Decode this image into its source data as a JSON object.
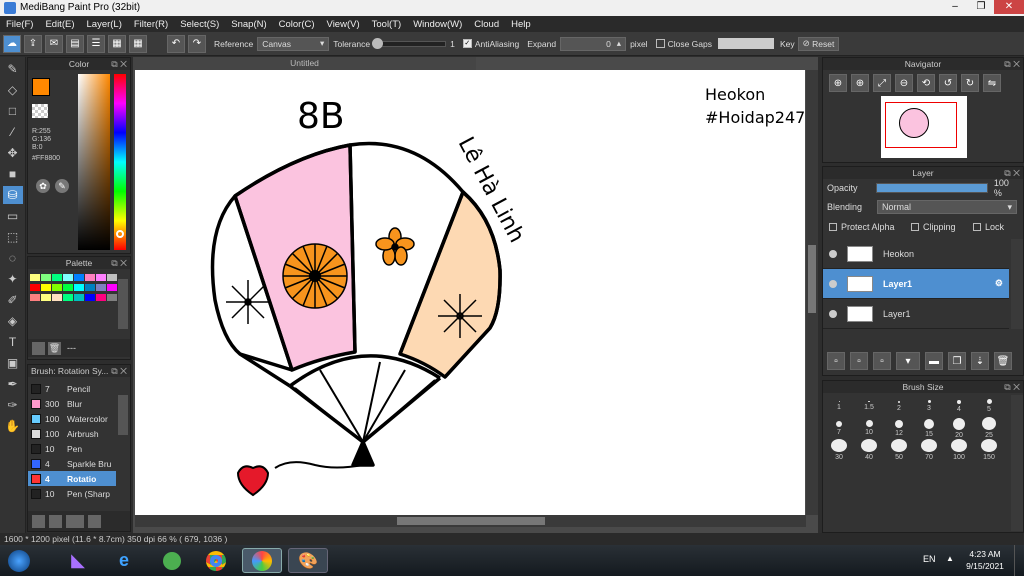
{
  "window": {
    "title": "MediBang Paint Pro (32bit)"
  },
  "menu": [
    "File(F)",
    "Edit(E)",
    "Layer(L)",
    "Filter(R)",
    "Select(S)",
    "Snap(N)",
    "Color(C)",
    "View(V)",
    "Tool(T)",
    "Window(W)",
    "Cloud",
    "Help"
  ],
  "toolbar": {
    "reference_label": "Reference",
    "reference_value": "Canvas",
    "tolerance_label": "Tolerance",
    "tolerance_value": "1",
    "antialias_label": "AntiAliasing",
    "expand_label": "Expand",
    "expand_value": "0",
    "expand_unit": "pixel",
    "close_gaps_label": "Close Gaps",
    "key_label": "Key",
    "reset_label": "Reset"
  },
  "color_panel": {
    "title": "Color",
    "r": "R:255",
    "g": "G:136",
    "b": "B:0",
    "hex": "#FF8800",
    "main_color": "#FF8800"
  },
  "palette_panel": {
    "title": "Palette",
    "swatches": [
      "#ffff80",
      "#80ff80",
      "#00ff80",
      "#80ffff",
      "#0080ff",
      "#ff80c0",
      "#ff80ff",
      "#c0c0c0",
      "#ff0000",
      "#ffff00",
      "#80ff00",
      "#00ff40",
      "#00ffff",
      "#0080c0",
      "#8080c0",
      "#ff00ff",
      "#ff8080",
      "#ffff80",
      "#ffe0c0",
      "#00ff80",
      "#00c0c0",
      "#0000ff",
      "#ff0080",
      "#808080"
    ],
    "footer": "---"
  },
  "brush_panel": {
    "title": "Brush: Rotation Sy...",
    "items": [
      {
        "size": "7",
        "name": "Pencil",
        "color": "#222222"
      },
      {
        "size": "300",
        "name": "Blur",
        "color": "#ff99cc"
      },
      {
        "size": "100",
        "name": "Watercolor",
        "color": "#66ccff"
      },
      {
        "size": "100",
        "name": "Airbrush",
        "color": "#dddddd"
      },
      {
        "size": "10",
        "name": "Pen",
        "color": "#222222"
      },
      {
        "size": "4",
        "name": "Sparkle Bru",
        "color": "#3366ff"
      },
      {
        "size": "4",
        "name": "Rotatio",
        "color": "#ff3333"
      },
      {
        "size": "10",
        "name": "Pen (Sharp",
        "color": "#222222"
      }
    ]
  },
  "canvas": {
    "tab_title": "Untitled"
  },
  "drawing": {
    "title": "8B",
    "name": "Lê Hà Linh",
    "sign1": "Heokon",
    "sign2": "#Hoidap247"
  },
  "navigator_panel": {
    "title": "Navigator"
  },
  "layer_panel": {
    "title": "Layer",
    "opacity_label": "Opacity",
    "opacity_value": "100 %",
    "opacity_level": 1.0,
    "blending_label": "Blending",
    "blending_value": "Normal",
    "protect_alpha_label": "Protect Alpha",
    "clipping_label": "Clipping",
    "lock_label": "Lock",
    "layers": [
      {
        "name": "Heokon",
        "active": false
      },
      {
        "name": "Layer1",
        "active": true
      },
      {
        "name": "Layer1",
        "active": false
      }
    ]
  },
  "brushsize_panel": {
    "title": "Brush Size",
    "sizes": [
      "1",
      "1.5",
      "2",
      "3",
      "4",
      "5",
      "7",
      "10",
      "12",
      "15",
      "20",
      "25",
      "30",
      "40",
      "50",
      "70",
      "100",
      "150"
    ]
  },
  "statusbar": {
    "text": "1600 * 1200 pixel   (11.6 * 8.7cm)   350 dpi   66 %   ( 679, 1036 )"
  },
  "taskbar": {
    "lang": "EN",
    "time": "4:23 AM",
    "date": "9/15/2021"
  }
}
